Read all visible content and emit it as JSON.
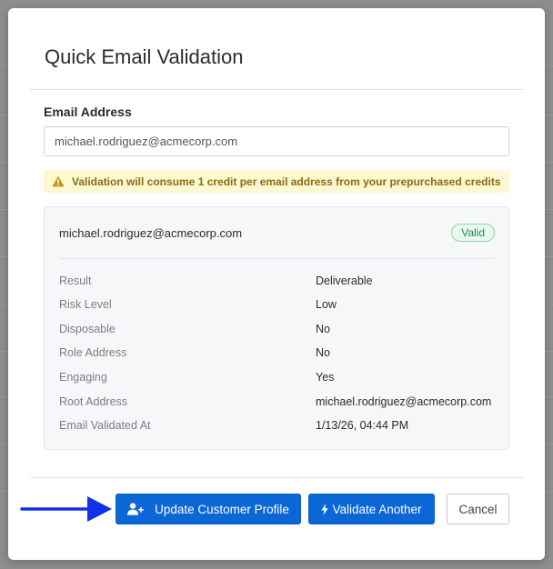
{
  "modal": {
    "title": "Quick Email Validation"
  },
  "form": {
    "email_label": "Email Address",
    "email_value": "michael.rodriguez@acmecorp.com",
    "email_placeholder": ""
  },
  "warning": {
    "text": "Validation will consume 1 credit per email address from your prepurchased credits",
    "icon": "warning-icon"
  },
  "result": {
    "email": "michael.rodriguez@acmecorp.com",
    "status_badge": "Valid",
    "details": [
      {
        "label": "Result",
        "value": "Deliverable"
      },
      {
        "label": "Risk Level",
        "value": "Low"
      },
      {
        "label": "Disposable",
        "value": "No"
      },
      {
        "label": "Role Address",
        "value": "No"
      },
      {
        "label": "Engaging",
        "value": "Yes"
      },
      {
        "label": "Root Address",
        "value": "michael.rodriguez@acmecorp.com"
      },
      {
        "label": "Email Validated At",
        "value": "1/13/26, 04:44 PM"
      }
    ]
  },
  "footer": {
    "update_label": "Update Customer Profile",
    "validate_label": "Validate Another",
    "cancel_label": "Cancel"
  },
  "colors": {
    "primary": "#0b67d6",
    "valid_green": "#1f8a4c",
    "warning_bg": "#fcf8d2",
    "arrow_blue": "#1232e6"
  }
}
